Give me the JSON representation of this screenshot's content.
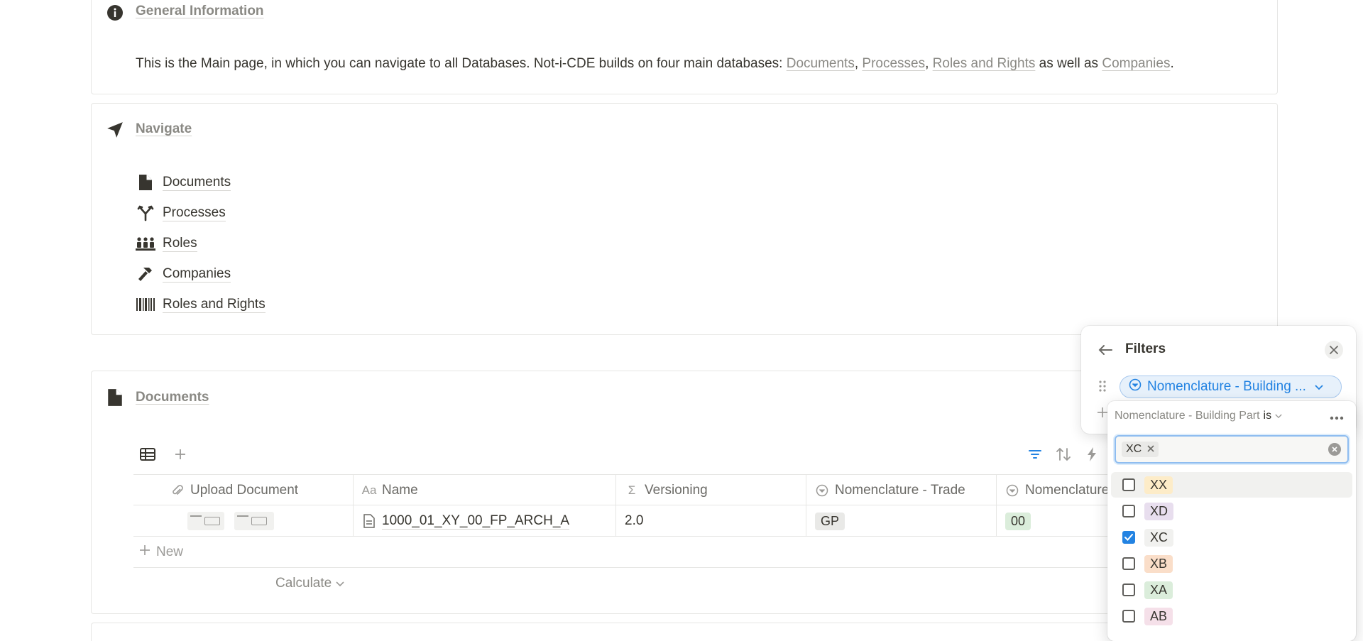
{
  "general": {
    "title": "General Information",
    "text_before": "This is the Main page, in which you can navigate to all Databases. Not-i-CDE builds on four main databases: ",
    "link_documents": "Documents",
    "sep1": ", ",
    "link_processes": "Processes",
    "sep2": ", ",
    "link_roles_rights": "Roles and Rights",
    "text_middle": " as well as ",
    "link_companies": "Companies",
    "text_end": "."
  },
  "navigate": {
    "title": "Navigate",
    "items": [
      {
        "label": "Documents",
        "icon": "document-icon"
      },
      {
        "label": "Processes",
        "icon": "branch-icon"
      },
      {
        "label": "Roles",
        "icon": "people-icon"
      },
      {
        "label": "Companies",
        "icon": "hammer-icon"
      },
      {
        "label": "Roles and Rights",
        "icon": "barcode-icon"
      }
    ]
  },
  "documents_section": {
    "title": "Documents",
    "columns": [
      {
        "label": "Upload Document",
        "icon": "paperclip-icon"
      },
      {
        "label": "Name",
        "icon": "Aa"
      },
      {
        "label": "Versioning",
        "icon": "Σ"
      },
      {
        "label": "Nomenclature - Trade",
        "icon": "select-icon"
      },
      {
        "label": "Nomenclature",
        "icon": "select-icon"
      }
    ],
    "rows": [
      {
        "name": "1000_01_XY_00_FP_ARCH_A",
        "versioning": "2.0",
        "trade": "GP",
        "nomenclature": "00"
      }
    ],
    "new_label": "New",
    "calculate_label": "Calculate"
  },
  "filters": {
    "title": "Filters",
    "pill_label": "Nomenclature - Building ...",
    "condition_property": "Nomenclature - Building Part",
    "condition_operator": "is",
    "selected_chip": "XC",
    "options": [
      {
        "label": "XX",
        "checked": false,
        "bg": "#fdecc8"
      },
      {
        "label": "XD",
        "checked": false,
        "bg": "#e8deee"
      },
      {
        "label": "XC",
        "checked": true,
        "bg": "#f1f1ef"
      },
      {
        "label": "XB",
        "checked": false,
        "bg": "#fadec9"
      },
      {
        "label": "XA",
        "checked": false,
        "bg": "#dbeddb"
      },
      {
        "label": "AB",
        "checked": false,
        "bg": "#f5e0e9"
      }
    ]
  },
  "colors": {
    "accent": "#2383e2",
    "text": "#37352f",
    "muted": "#8a8984",
    "tag_gp": "#e9e9e7",
    "tag_00": "#dbeddb"
  }
}
